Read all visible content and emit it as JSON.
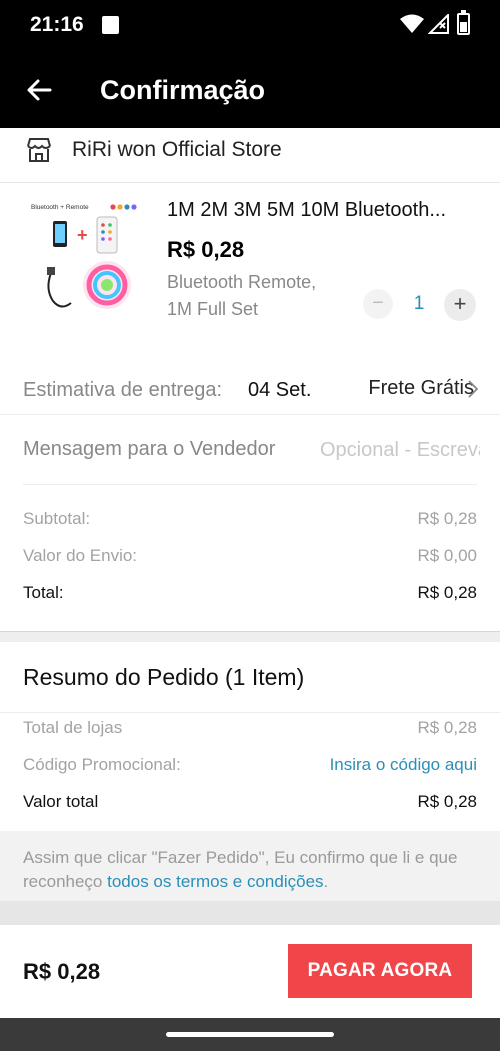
{
  "status_bar": {
    "time": "21:16"
  },
  "app_bar": {
    "title": "Confirmação"
  },
  "store": {
    "name": "RiRi won Official Store"
  },
  "product": {
    "name": "1M 2M 3M 5M 10M Bluetooth...",
    "price": "R$ 0,28",
    "variant_line1": "Bluetooth Remote,",
    "variant_line2": "1M Full Set",
    "quantity": "1",
    "minus_label": "−",
    "plus_label": "+",
    "thumb_caption": "Bluetooth + Remote"
  },
  "delivery": {
    "label": "Estimativa de entrega:",
    "date": "04 Set.",
    "shipping": "Frete Grátis"
  },
  "message": {
    "label": "Mensagem para o Vendedor",
    "placeholder": "Opcional - Escreva"
  },
  "store_summary": [
    {
      "key": "Subtotal:",
      "value": "R$ 0,28"
    },
    {
      "key": "Valor do Envio:",
      "value": "R$ 0,00"
    },
    {
      "key": "Total:",
      "value": "R$ 0,28"
    }
  ],
  "order_summary": {
    "heading": "Resumo do Pedido (1 Item)",
    "total_stores_label": "Total de lojas",
    "total_stores_value": "R$ 0,28",
    "promo_label": "Código Promocional:",
    "promo_link": "Insira o código aqui",
    "grand_total_label": "Valor total",
    "grand_total_value": "R$ 0,28"
  },
  "terms": {
    "text": "Assim que clicar \"Fazer Pedido\", Eu confirmo que li e que reconheço ",
    "link": "todos os termos e condições",
    "end": "."
  },
  "footer": {
    "total": "R$ 0,28",
    "pay_button": "PAGAR AGORA"
  },
  "colors": {
    "accent": "#f0464a",
    "link": "#2a8fb7",
    "header_bg": "#000000"
  }
}
